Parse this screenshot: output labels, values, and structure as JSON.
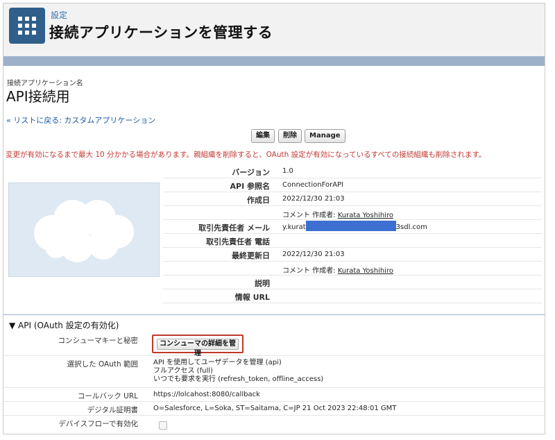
{
  "header": {
    "super_title": "設定",
    "title": "接続アプリケーションを管理する",
    "icon": "app-grid-icon",
    "icon_color": "#2f5f8a"
  },
  "record": {
    "label": "接続アプリケーション名",
    "name": "API接続用"
  },
  "back_link": "« リストに戻る: カスタムアプリケーション",
  "buttons": {
    "edit": "編集",
    "delete": "削除",
    "manage": "Manage"
  },
  "warning": "変更が有効になるまで最大 10 分かかる場合があります。親組織を削除すると、OAuth 設定が有効になっているすべての接続組織も削除されます。",
  "details": {
    "version_label": "バージョン",
    "version": "1.0",
    "api_name_label": "API 参照名",
    "api_name": "ConnectionForAPI",
    "created_label": "作成日",
    "created_date": "2022/12/30 21:03",
    "created_by_prefix": "コメント 作成者: ",
    "created_by": "Kurata Yoshihiro",
    "contact_email_label": "取引先責任者 メール",
    "contact_email_start": "y.kurat",
    "contact_email_end": "3sdl.com",
    "contact_phone_label": "取引先責任者 電話",
    "modified_label": "最終更新日",
    "modified_date": "2022/12/30 21:03",
    "modified_by_prefix": "コメント 作成者: ",
    "modified_by": "Kurata Yoshihiro",
    "description_label": "説明",
    "info_url_label": "情報 URL"
  },
  "api_section": {
    "heading": "▼ API (OAuth 設定の有効化)",
    "consumer_label": "コンシューマキーと秘密",
    "consumer_button": "コンシューマの詳細を管理",
    "scopes_label": "選択した OAuth 範囲",
    "scope_1": "API を使用してユーザデータを管理 (api)",
    "scope_2": "フルアクセス (full)",
    "scope_3": "いつでも要求を実行 (refresh_token, offline_access)",
    "callback_label": "コールバック URL",
    "callback_url": "https://lolcahost:8080/callback",
    "cert_label": "デジタル証明書",
    "cert_value": "O=Salesforce, L=Soka, ST=Saitama, C=JP 21 Oct 2023 22:48:01 GMT",
    "device_flow_label": "デバイスフローで有効化"
  },
  "colors": {
    "accent": "#2f6fb0",
    "warning": "#c23934",
    "highlight_border": "#c0392b",
    "band": "#9db2c9"
  }
}
